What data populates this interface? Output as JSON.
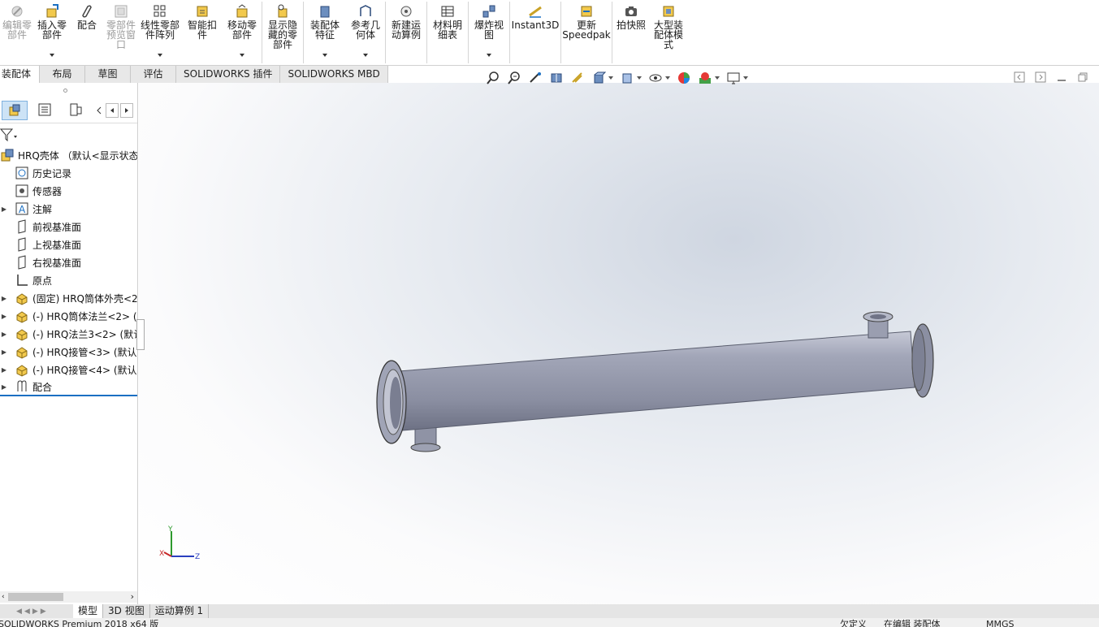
{
  "ribbon": {
    "buttons": [
      {
        "label": "编辑零\n部件",
        "icon": "edit-component-icon",
        "disabled": true
      },
      {
        "label": "插入零\n部件",
        "icon": "insert-component-icon",
        "dropdown": true
      },
      {
        "label": "配合",
        "icon": "mate-icon"
      },
      {
        "label": "零部件\n预览窗\n口",
        "icon": "component-preview-icon",
        "disabled": true
      },
      {
        "label": "线性零部\n件阵列",
        "icon": "linear-pattern-icon",
        "dropdown": true
      },
      {
        "label": "智能扣\n件",
        "icon": "smart-fastener-icon"
      },
      {
        "label": "移动零\n部件",
        "icon": "move-component-icon",
        "dropdown": true
      },
      {
        "label": "显示隐\n藏的零\n部件",
        "icon": "show-hidden-icon"
      },
      {
        "label": "装配体\n特征",
        "icon": "assembly-feature-icon",
        "dropdown": true
      },
      {
        "label": "参考几\n何体",
        "icon": "reference-geometry-icon",
        "dropdown": true
      },
      {
        "label": "新建运\n动算例",
        "icon": "new-motion-study-icon"
      },
      {
        "label": "材料明\n细表",
        "icon": "bom-icon"
      },
      {
        "label": "爆炸视\n图",
        "icon": "exploded-view-icon",
        "dropdown": true
      },
      {
        "label": "Instant3D",
        "icon": "instant3d-icon"
      },
      {
        "label": "更新\nSpeedpak",
        "icon": "speedpak-icon"
      },
      {
        "label": "拍快照",
        "icon": "snapshot-icon"
      },
      {
        "label": "大型装\n配体模\n式",
        "icon": "large-assembly-icon"
      }
    ]
  },
  "command_tabs": [
    "装配体",
    "布局",
    "草图",
    "评估",
    "SOLIDWORKS 插件",
    "SOLIDWORKS MBD"
  ],
  "tree": {
    "root": "HRQ壳体 （默认<显示状态-",
    "items": [
      {
        "label": "历史记录",
        "icon": "history-icon",
        "expand": false
      },
      {
        "label": "传感器",
        "icon": "sensor-icon",
        "expand": false
      },
      {
        "label": "注解",
        "icon": "annotation-icon",
        "expand": true
      },
      {
        "label": "前视基准面",
        "icon": "plane-icon",
        "expand": false
      },
      {
        "label": "上视基准面",
        "icon": "plane-icon",
        "expand": false
      },
      {
        "label": "右视基准面",
        "icon": "plane-icon",
        "expand": false
      },
      {
        "label": "原点",
        "icon": "origin-icon",
        "expand": false
      },
      {
        "label": "(固定) HRQ筒体外壳<2",
        "icon": "part-icon",
        "expand": true
      },
      {
        "label": "(-) HRQ筒体法兰<2> (",
        "icon": "part-icon",
        "expand": true
      },
      {
        "label": "(-) HRQ法兰3<2> (默认",
        "icon": "part-icon",
        "expand": true
      },
      {
        "label": "(-) HRQ接管<3> (默认",
        "icon": "part-icon",
        "expand": true
      },
      {
        "label": "(-) HRQ接管<4> (默认",
        "icon": "part-icon",
        "expand": true
      },
      {
        "label": "配合",
        "icon": "mates-folder-icon",
        "expand": true
      }
    ]
  },
  "triad": {
    "x": "X",
    "y": "Y",
    "z": "Z"
  },
  "bottom_tabs": [
    "模型",
    "3D 视图",
    "运动算例 1"
  ],
  "status": {
    "left": "SOLIDWORKS Premium 2018 x64 版",
    "defined": "欠定义",
    "editing": "在编辑 装配体",
    "units": "MMGS"
  },
  "colors": {
    "model": "#8e93a6",
    "accent": "#1b6fc2"
  }
}
